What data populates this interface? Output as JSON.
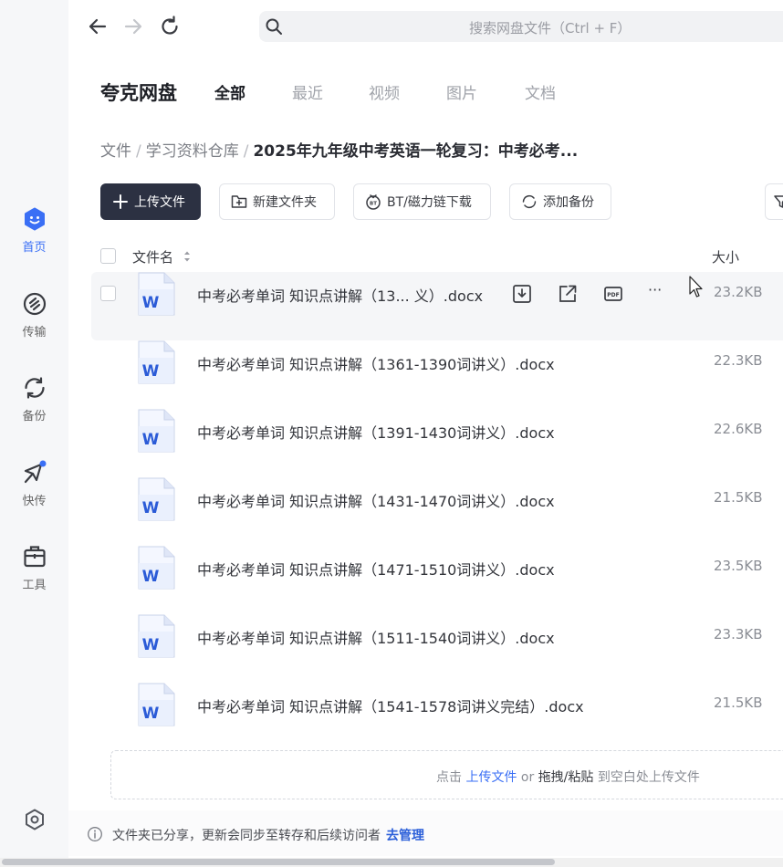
{
  "sidebar": {
    "items": [
      {
        "label": "首页",
        "icon": "home-icon"
      },
      {
        "label": "传输",
        "icon": "transfer-icon"
      },
      {
        "label": "备份",
        "icon": "backup-icon"
      },
      {
        "label": "快传",
        "icon": "quick-send-icon"
      },
      {
        "label": "工具",
        "icon": "toolbox-icon"
      }
    ],
    "accent_color": "#3a6ff5"
  },
  "search": {
    "placeholder": "搜索网盘文件（Ctrl + F）"
  },
  "header": {
    "brand": "夸克网盘",
    "tabs": [
      "全部",
      "最近",
      "视频",
      "图片",
      "文档"
    ],
    "active_tab": "全部"
  },
  "breadcrumb": {
    "items": [
      "文件",
      "学习资料仓库"
    ],
    "current": "2025年九年级中考英语一轮复习：中考必考..."
  },
  "toolbar": {
    "upload_label": "上传文件",
    "new_folder_label": "新建文件夹",
    "bt_label": "BT/磁力链下载",
    "backup_label": "添加备份"
  },
  "list": {
    "header_name": "文件名",
    "header_size": "大小",
    "files": [
      {
        "name": "中考必考单词 知识点讲解（13... 义）.docx",
        "size": "23.2KB",
        "type": "docx"
      },
      {
        "name": "中考必考单词 知识点讲解（1361-1390词讲义）.docx",
        "size": "22.3KB",
        "type": "docx"
      },
      {
        "name": "中考必考单词 知识点讲解（1391-1430词讲义）.docx",
        "size": "22.6KB",
        "type": "docx"
      },
      {
        "name": "中考必考单词 知识点讲解（1431-1470词讲义）.docx",
        "size": "21.5KB",
        "type": "docx"
      },
      {
        "name": "中考必考单词 知识点讲解（1471-1510词讲义）.docx",
        "size": "23.5KB",
        "type": "docx"
      },
      {
        "name": "中考必考单词 知识点讲解（1511-1540词讲义）.docx",
        "size": "23.3KB",
        "type": "docx"
      },
      {
        "name": "中考必考单词 知识点讲解（1541-1578词讲义完结）.docx",
        "size": "21.5KB",
        "type": "docx"
      }
    ],
    "hover_actions": [
      "download-icon",
      "share-icon",
      "pdf-icon",
      "more-icon"
    ],
    "more_label": "···"
  },
  "dropzone": {
    "prefix": "点击",
    "upload_link": "上传文件",
    "or": "or",
    "drag": "拖拽/粘贴",
    "suffix": "到空白处上传文件"
  },
  "footer": {
    "notice": "文件夹已分享，更新会同步至转存和后续访问者",
    "manage_link": "去管理"
  },
  "colors": {
    "primary_button": "#2c3142",
    "link": "#2b5fd9",
    "word_icon": "#2b5bd7"
  }
}
